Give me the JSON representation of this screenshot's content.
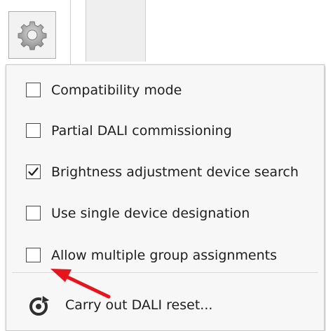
{
  "toolbar": {
    "settings_icon": "gear-icon"
  },
  "menu": {
    "options": [
      {
        "label": "Compatibility mode",
        "checked": false
      },
      {
        "label": "Partial DALI commissioning",
        "checked": false
      },
      {
        "label": "Brightness adjustment device search",
        "checked": true
      },
      {
        "label": "Use single device designation",
        "checked": false
      },
      {
        "label": "Allow multiple group assignments",
        "checked": false
      }
    ],
    "reset_label": "Carry out DALI reset...",
    "reset_icon": "reset-icon"
  },
  "colors": {
    "annotation_arrow": "#e8141c",
    "menu_background": "#f7f7f7"
  }
}
